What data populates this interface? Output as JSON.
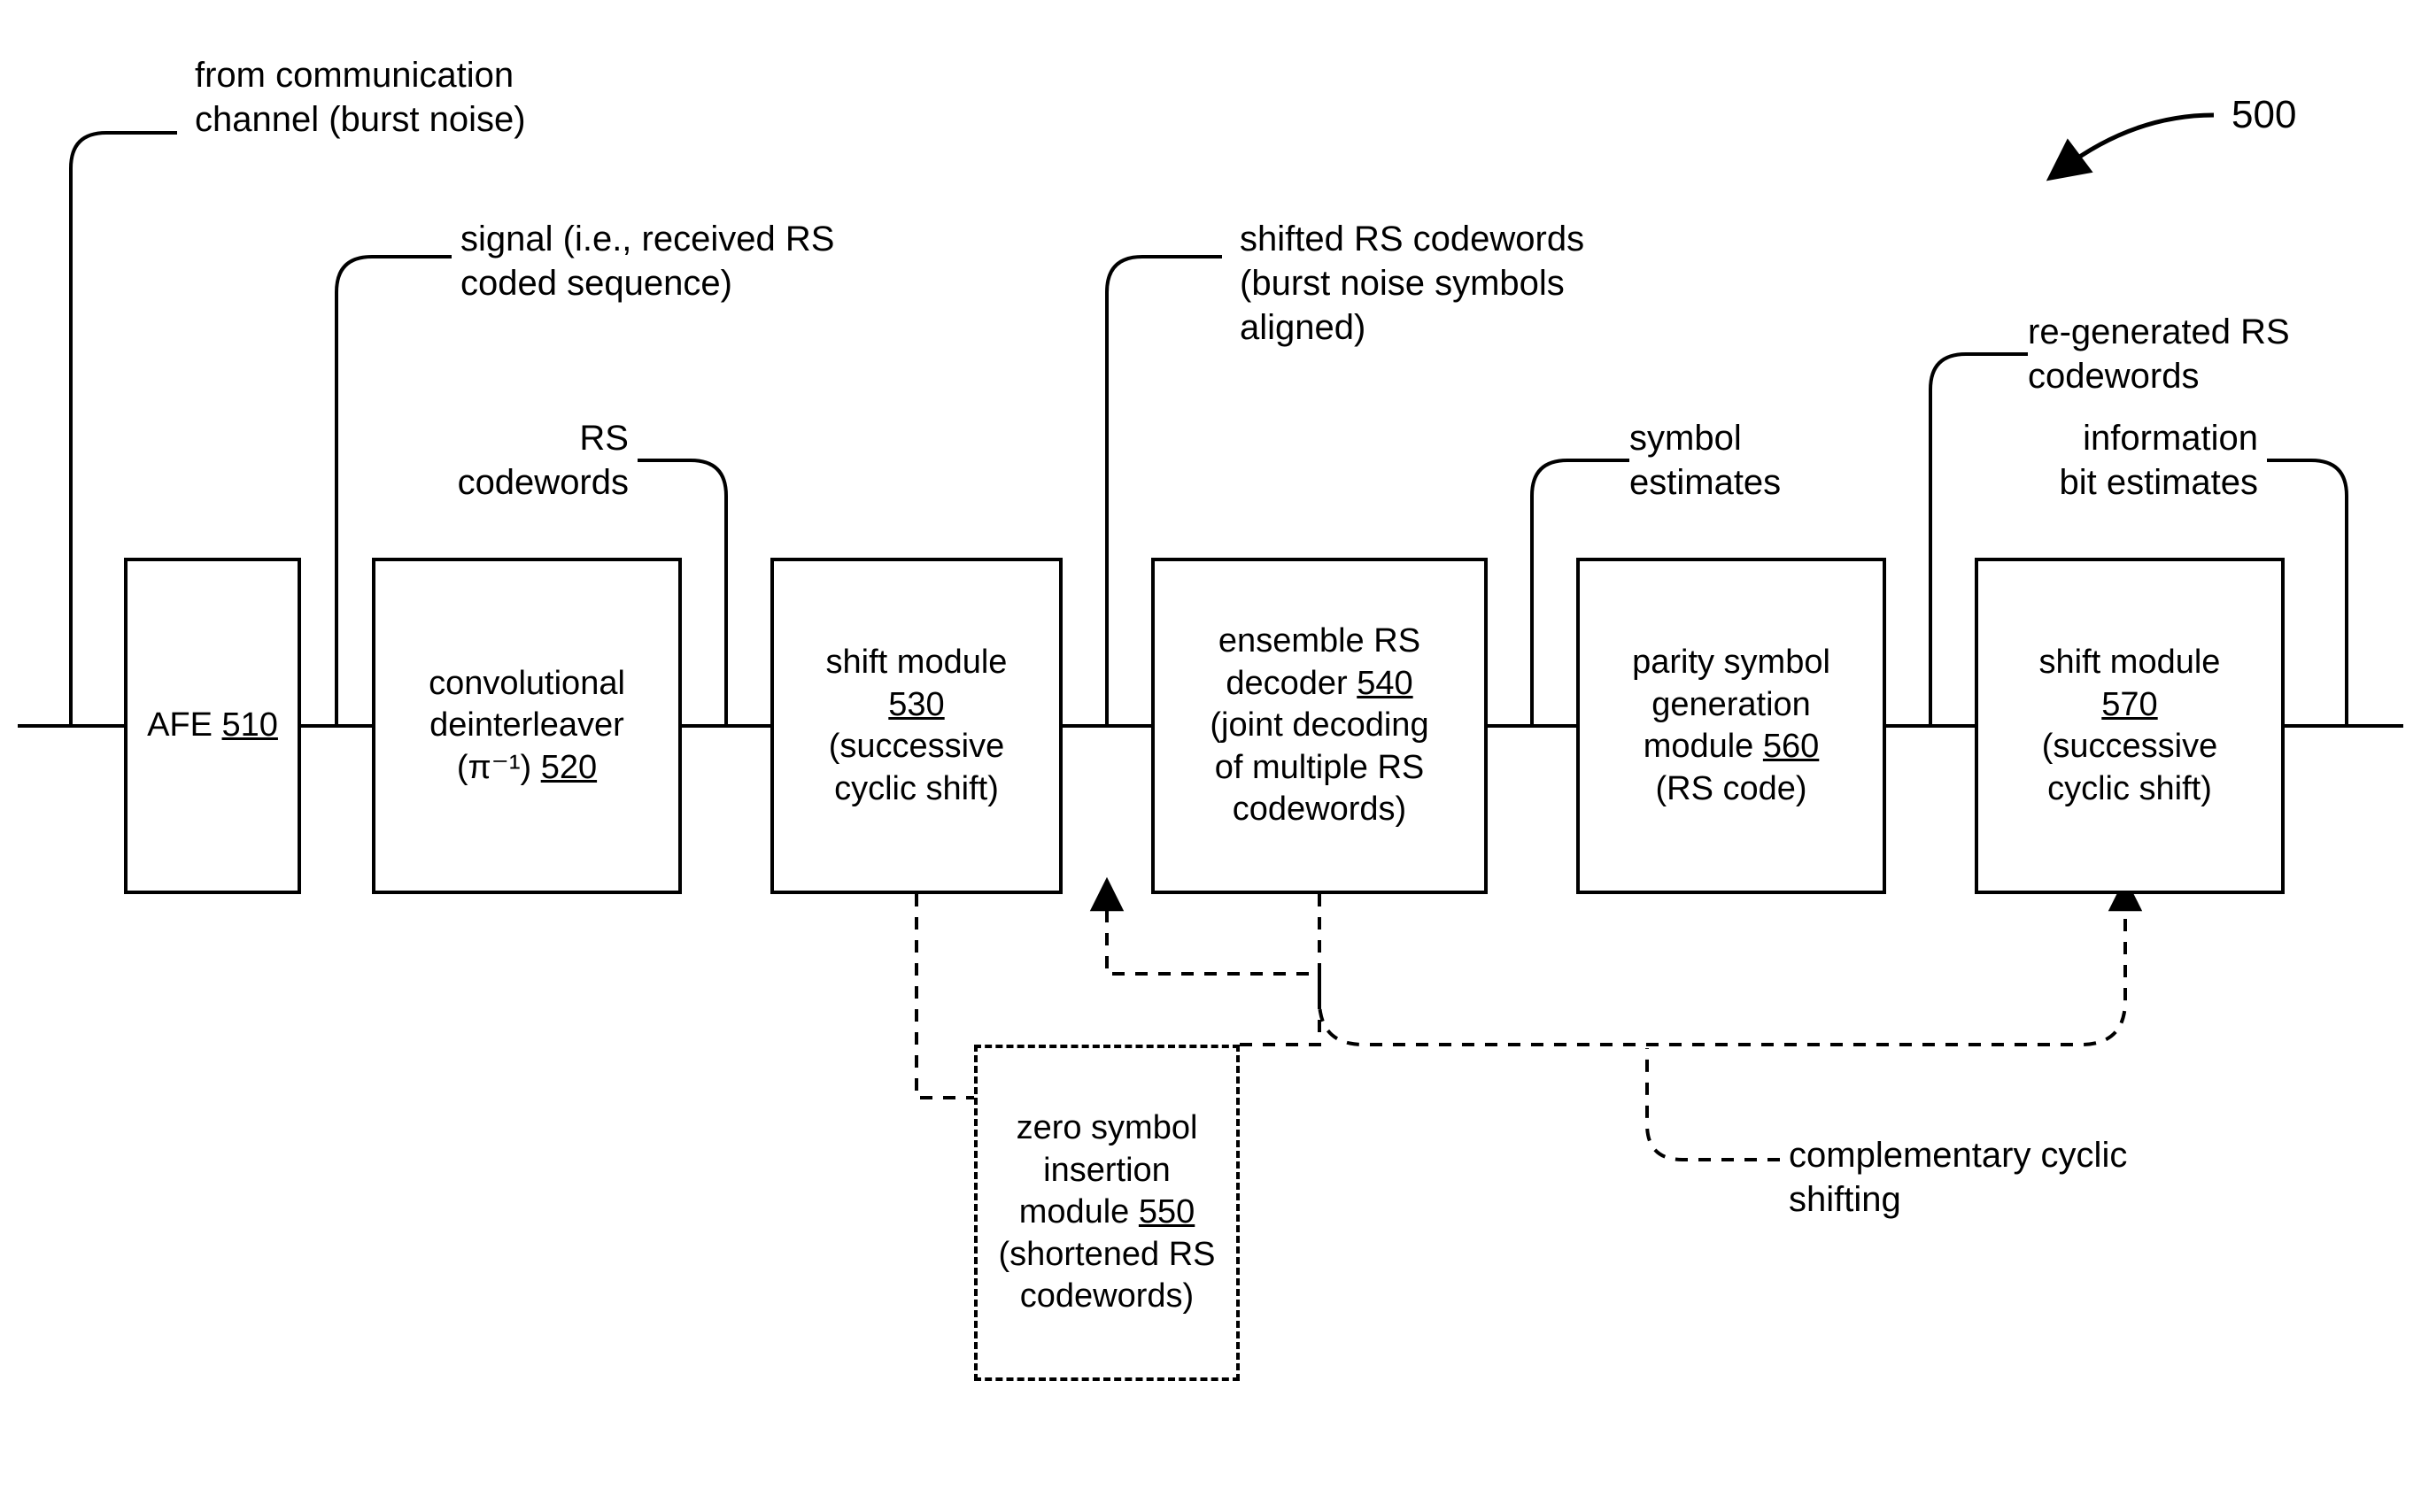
{
  "figure_number": "500",
  "labels": {
    "l_channel": "from communication\nchannel (burst noise)",
    "l_signal": "signal (i.e., received RS\ncoded sequence)",
    "l_rs_cw": "RS\ncodewords",
    "l_shifted": "shifted RS codewords\n(burst noise symbols\naligned)",
    "l_sym_est": "symbol\nestimates",
    "l_regen": "re-generated RS\ncodewords",
    "l_info": "information\nbit estimates",
    "l_comp": "complementary cyclic\nshifting"
  },
  "boxes": {
    "afe": {
      "pre": "AFE ",
      "num": "510",
      "post": ""
    },
    "deint": {
      "pre": "convolutional\ndeinterleaver\n(π⁻¹) ",
      "num": "520",
      "post": ""
    },
    "shift1": {
      "pre": "shift module\n",
      "num": "530",
      "post": "\n(successive\ncyclic shift)"
    },
    "ens": {
      "pre": "ensemble RS\ndecoder ",
      "num": "540",
      "post": "\n(joint decoding\nof multiple RS\ncodewords)"
    },
    "zero": {
      "pre": "zero symbol\ninsertion\nmodule ",
      "num": "550",
      "post": "\n(shortened RS\ncodewords)"
    },
    "parity": {
      "pre": "parity symbol\ngeneration\nmodule ",
      "num": "560",
      "post": "\n(RS code)"
    },
    "shift2": {
      "pre": "shift module\n",
      "num": "570",
      "post": "\n(successive\ncyclic shift)"
    }
  }
}
